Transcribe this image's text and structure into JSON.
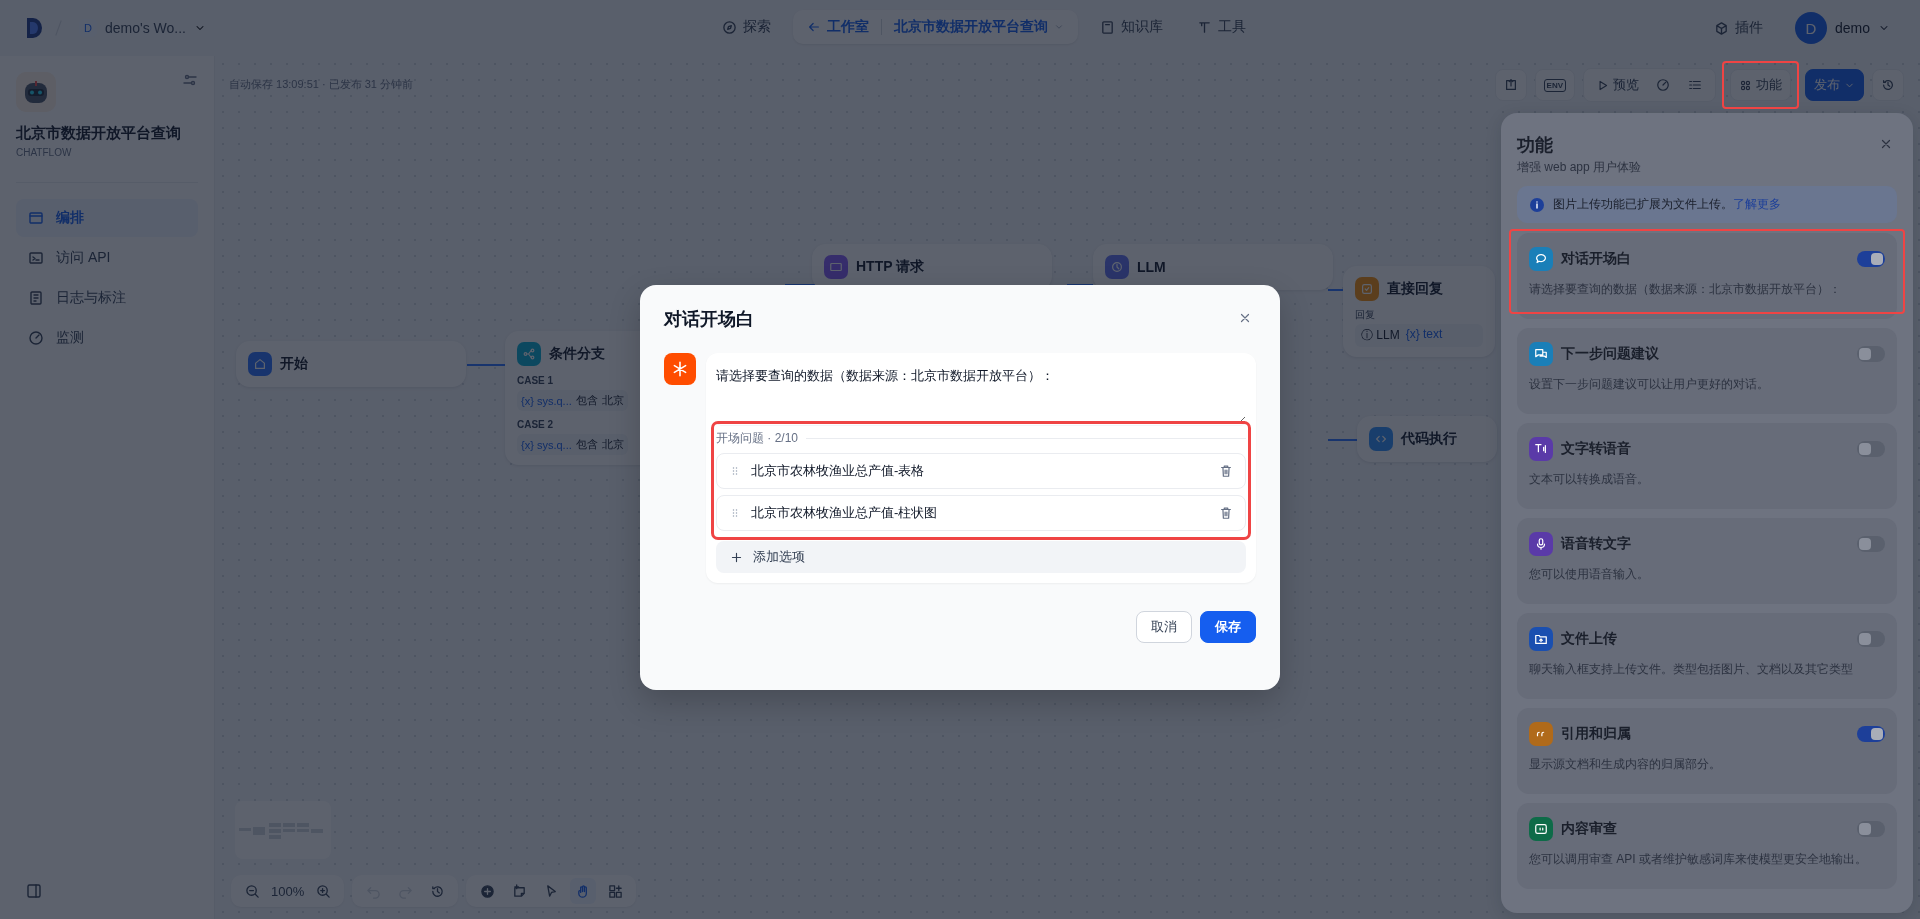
{
  "top_bar": {
    "workspace_avatar": "D",
    "workspace_name": "demo's Wo...",
    "nav": [
      {
        "kind": "link",
        "label": "探索",
        "selected": false
      },
      {
        "kind": "studio",
        "label": "工作室",
        "app": "北京市数据开放平台查询",
        "selected": true
      },
      {
        "kind": "link",
        "label": "知识库",
        "selected": false
      },
      {
        "kind": "link",
        "label": "工具",
        "selected": false
      }
    ],
    "plugins": "插件",
    "user_avatar": "D",
    "user_name": "demo"
  },
  "sidebar": {
    "app_name": "北京市数据开放平台查询",
    "app_type": "CHATFLOW",
    "items": [
      {
        "label": "编排",
        "selected": true
      },
      {
        "label": "访问 API",
        "selected": false
      },
      {
        "label": "日志与标注",
        "selected": false
      },
      {
        "label": "监测",
        "selected": false
      }
    ]
  },
  "canvas": {
    "autosave": "自动保存 13:09:51 · 已发布 31 分钟前",
    "toolbar": {
      "env": "ENV",
      "preview": "预览",
      "features": "功能",
      "features_highlighted": true,
      "publish": "发布"
    },
    "nodes": [
      {
        "kind": "start",
        "title": "开始"
      },
      {
        "kind": "if-else",
        "title": "条件分支",
        "cases": [
          {
            "label": "CASE 1",
            "variable": "{x} sys.q...",
            "operator": "包含",
            "value": "北京"
          },
          {
            "label": "CASE 2",
            "variable": "{x} sys.q...",
            "operator": "包含",
            "value": "北京"
          }
        ]
      },
      {
        "kind": "http",
        "title": "HTTP 请求"
      },
      {
        "kind": "llm",
        "title": "LLM"
      },
      {
        "kind": "answer",
        "title": "直接回复",
        "field": "回复",
        "chips": [
          "ⓘ LLM",
          "{x} text"
        ]
      },
      {
        "kind": "code",
        "title": "代码执行"
      }
    ],
    "zoom": "100%"
  },
  "modal": {
    "title": "对话开场白",
    "opener": "请选择要查询的数据（数据来源：北京市数据开放平台）：",
    "questions_label": "开场问题 · 2/10",
    "questions_highlighted": true,
    "questions": [
      "北京市农林牧渔业总产值-表格",
      "北京市农林牧渔业总产值-柱状图"
    ],
    "add_option": "添加选项",
    "cancel": "取消",
    "save": "保存"
  },
  "feature_panel": {
    "title": "功能",
    "subtitle": "增强 web app 用户体验",
    "notice": "图片上传功能已扩展为文件上传。",
    "notice_link": "了解更多",
    "features": [
      {
        "kind": "opener",
        "title": "对话开场白",
        "description": "请选择要查询的数据（数据来源：北京市数据开放平台）：",
        "on": true,
        "color": "#1a7fb8",
        "highlighted": true
      },
      {
        "kind": "suggest",
        "title": "下一步问题建议",
        "description": "设置下一步问题建议可以让用户更好的对话。",
        "on": false,
        "color": "#1a7fb8",
        "highlighted": false
      },
      {
        "kind": "tts",
        "title": "文字转语音",
        "description": "文本可以转换成语音。",
        "on": false,
        "color": "#5a3aa8",
        "highlighted": false
      },
      {
        "kind": "stt",
        "title": "语音转文字",
        "description": "您可以使用语音输入。",
        "on": false,
        "color": "#5a3aa8",
        "highlighted": false
      },
      {
        "kind": "upload",
        "title": "文件上传",
        "description": "聊天输入框支持上传文件。类型包括图片、文档以及其它类型",
        "on": false,
        "color": "#1a4fb0",
        "highlighted": false
      },
      {
        "kind": "citation",
        "title": "引用和归属",
        "description": "显示源文档和生成内容的归属部分。",
        "on": true,
        "color": "#b06a1a",
        "highlighted": false
      },
      {
        "kind": "moderation",
        "title": "内容审查",
        "description": "您可以调用审查 API 或者维护敏感词库来使模型更安全地输出。",
        "on": false,
        "color": "#0e6b48",
        "highlighted": false
      }
    ]
  }
}
